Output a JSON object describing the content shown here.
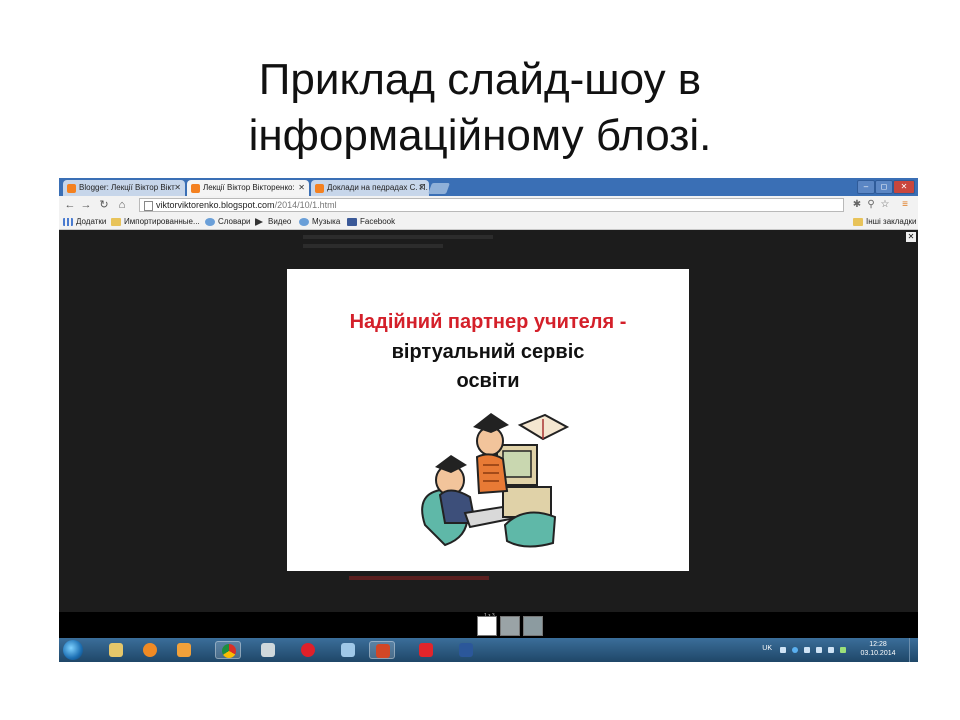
{
  "slide": {
    "title_line1": "Приклад слайд-шоу  в",
    "title_line2": "інформаційному блозі."
  },
  "browser": {
    "tabs": [
      {
        "label": "Blogger: Лекції Віктор Вікт",
        "active": false
      },
      {
        "label": "Лекції Віктор Вікторенко:",
        "active": true
      },
      {
        "label": "Доклади на педрадах С. П.",
        "active": false
      }
    ],
    "tab_close": "✕",
    "window_controls": [
      "–",
      "◻",
      "✕"
    ],
    "url_host": "viktorviktorenko.blogspot.com",
    "url_path": "/2014/10/1.html",
    "bookmarks": [
      {
        "label": "Додатки",
        "icon": "apps-icon"
      },
      {
        "label": "Импортированные...",
        "icon": "folder-icon"
      },
      {
        "label": "Словари",
        "icon": "globe-icon"
      },
      {
        "label": "Видео",
        "icon": "play-icon"
      },
      {
        "label": "Музыка",
        "icon": "globe-icon"
      },
      {
        "label": "Facebook",
        "icon": "facebook-icon"
      }
    ],
    "other_bookmarks": "Інші закладки"
  },
  "lightbox": {
    "slide_heading_red": "Надійний партнер  учителя -",
    "slide_heading_line2": "віртуальний сервіс",
    "slide_heading_line3": "освіти",
    "counter": "1 з 3",
    "close_glyph": "✕"
  },
  "taskbar": {
    "language": "UK",
    "time": "12:28",
    "date": "03.10.2014"
  },
  "colors": {
    "tabstrip": "#3a6fb5",
    "slide_heading_red": "#d4202a",
    "lightbox_bg": "#1c1c1c"
  }
}
